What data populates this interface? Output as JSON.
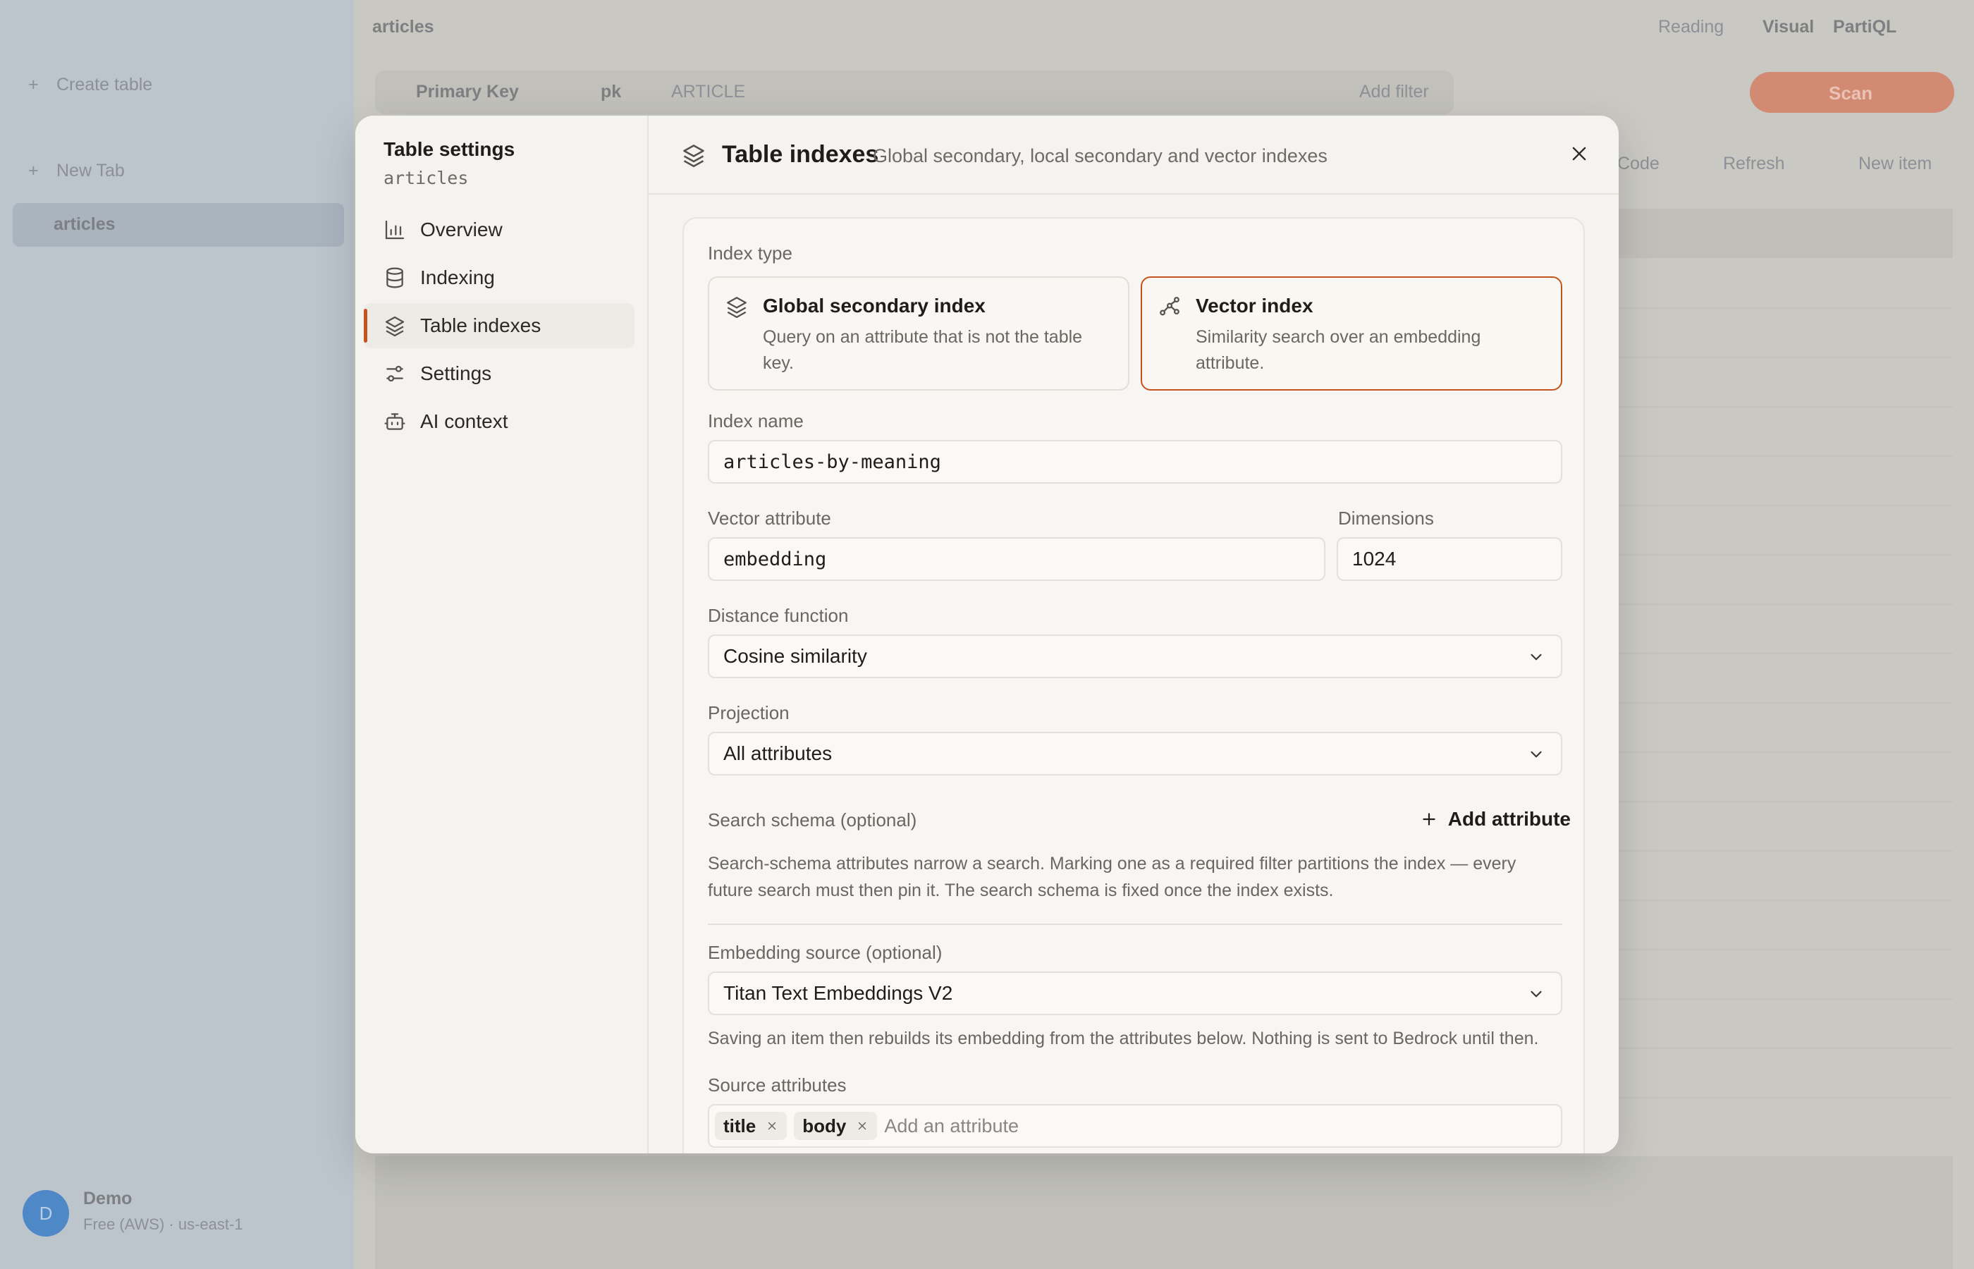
{
  "background": {
    "sidebar": {
      "create_table": "Create table",
      "new_tab": "New Tab",
      "active_table": "articles",
      "user_name": "Demo",
      "user_sub": "Free (AWS) · us-east-1",
      "avatar_letter": "D"
    },
    "topbar": {
      "table": "articles",
      "reading": "Reading",
      "visual": "Visual",
      "partiql": "PartiQL"
    },
    "toolbar": {
      "index": "Primary Key",
      "pk": "pk",
      "value": "ARTICLE",
      "add_filter": "Add filter",
      "run": "Scan",
      "code": "Code",
      "refresh": "Refresh",
      "new_item": "New item"
    }
  },
  "modal": {
    "nav": {
      "title": "Table settings",
      "subtitle": "articles",
      "items": [
        {
          "label": "Overview",
          "icon": "bar-chart-icon"
        },
        {
          "label": "Indexing",
          "icon": "database-icon"
        },
        {
          "label": "Table indexes",
          "icon": "layers-icon",
          "active": true
        },
        {
          "label": "Settings",
          "icon": "sliders-icon"
        },
        {
          "label": "AI context",
          "icon": "bot-icon"
        }
      ]
    },
    "header": {
      "title": "Table indexes",
      "subtitle": "Global secondary, local secondary and vector indexes"
    },
    "form": {
      "index_type_label": "Index type",
      "types": [
        {
          "title": "Global secondary index",
          "desc": "Query on an attribute that is not the table key.",
          "selected": false
        },
        {
          "title": "Vector index",
          "desc": "Similarity search over an embedding attribute.",
          "selected": true
        }
      ],
      "index_name_label": "Index name",
      "index_name_value": "articles-by-meaning",
      "vector_attr_label": "Vector attribute",
      "vector_attr_value": "embedding",
      "dimensions_label": "Dimensions",
      "dimensions_value": "1024",
      "distance_label": "Distance function",
      "distance_value": "Cosine similarity",
      "projection_label": "Projection",
      "projection_value": "All attributes",
      "schema_label": "Search schema (optional)",
      "add_attribute": "Add attribute",
      "schema_help": "Search-schema attributes narrow a search. Marking one as a required filter partitions the index — every future search must then pin it. The search schema is fixed once the index exists.",
      "embedding_label": "Embedding source (optional)",
      "embedding_value": "Titan Text Embeddings V2",
      "embedding_help": "Saving an item then rebuilds its embedding from the attributes below. Nothing is sent to Bedrock until then.",
      "source_label": "Source attributes",
      "source_chips": [
        "title",
        "body"
      ],
      "source_placeholder": "Add an attribute"
    }
  }
}
